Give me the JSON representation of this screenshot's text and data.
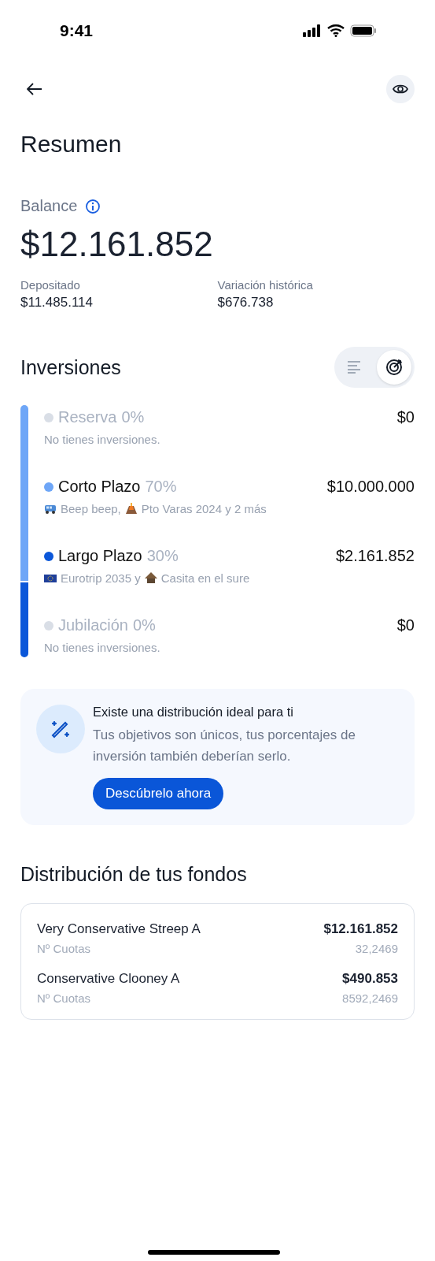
{
  "status_bar": {
    "time": "9:41"
  },
  "title": "Resumen",
  "balance": {
    "label": "Balance",
    "amount": "$12.161.852",
    "stats": [
      {
        "label": "Depositado",
        "value": "$11.485.114"
      },
      {
        "label": "Variación histórica",
        "value": "$676.738"
      }
    ]
  },
  "investments": {
    "title": "Inversiones",
    "view_toggle": [
      {
        "kind": "list",
        "selected": false
      },
      {
        "kind": "target",
        "selected": true
      }
    ],
    "categories": [
      {
        "name": "Reserva",
        "percent": "0%",
        "amount": "$0",
        "disabled": true,
        "color": "#d9dee6",
        "level": 0,
        "note": "No tienes inversiones."
      },
      {
        "name": "Corto Plazo",
        "percent": "70%",
        "amount": "$10.000.000",
        "disabled": false,
        "color": "#6ea6f7",
        "level": 0.7,
        "goals": [
          {
            "kind": "van",
            "name": "Beep beep,"
          },
          {
            "kind": "volcano",
            "name": "Pto Varas 2024 y 2 más"
          }
        ]
      },
      {
        "name": "Largo Plazo",
        "percent": "30%",
        "amount": "$2.161.852",
        "disabled": false,
        "color": "#0b57d9",
        "level": 0.3,
        "goals": [
          {
            "kind": "flag",
            "name": "Eurotrip 2035 y"
          },
          {
            "kind": "hut",
            "name": "Casita en el sure"
          }
        ]
      },
      {
        "name": "Jubilación",
        "percent": "0%",
        "amount": "$0",
        "disabled": true,
        "color": "#d9dee6",
        "level": 0,
        "note": "No tienes inversiones."
      }
    ]
  },
  "promo": {
    "title": "Existe una distribución ideal para ti",
    "text": "Tus objetivos son únicos, tus porcentajes de inversión también deberían serlo.",
    "button": "Descúbrelo ahora"
  },
  "funds": {
    "title": "Distribución de tus fondos",
    "rows": [
      {
        "name": "Very Conservative Streep A",
        "amount": "$12.161.852",
        "units_label": "Nº Cuotas",
        "units": "32,2469"
      },
      {
        "name": "Conservative Clooney A",
        "amount": "$490.853",
        "units_label": "Nº Cuotas",
        "units": "8592,2469"
      }
    ]
  }
}
